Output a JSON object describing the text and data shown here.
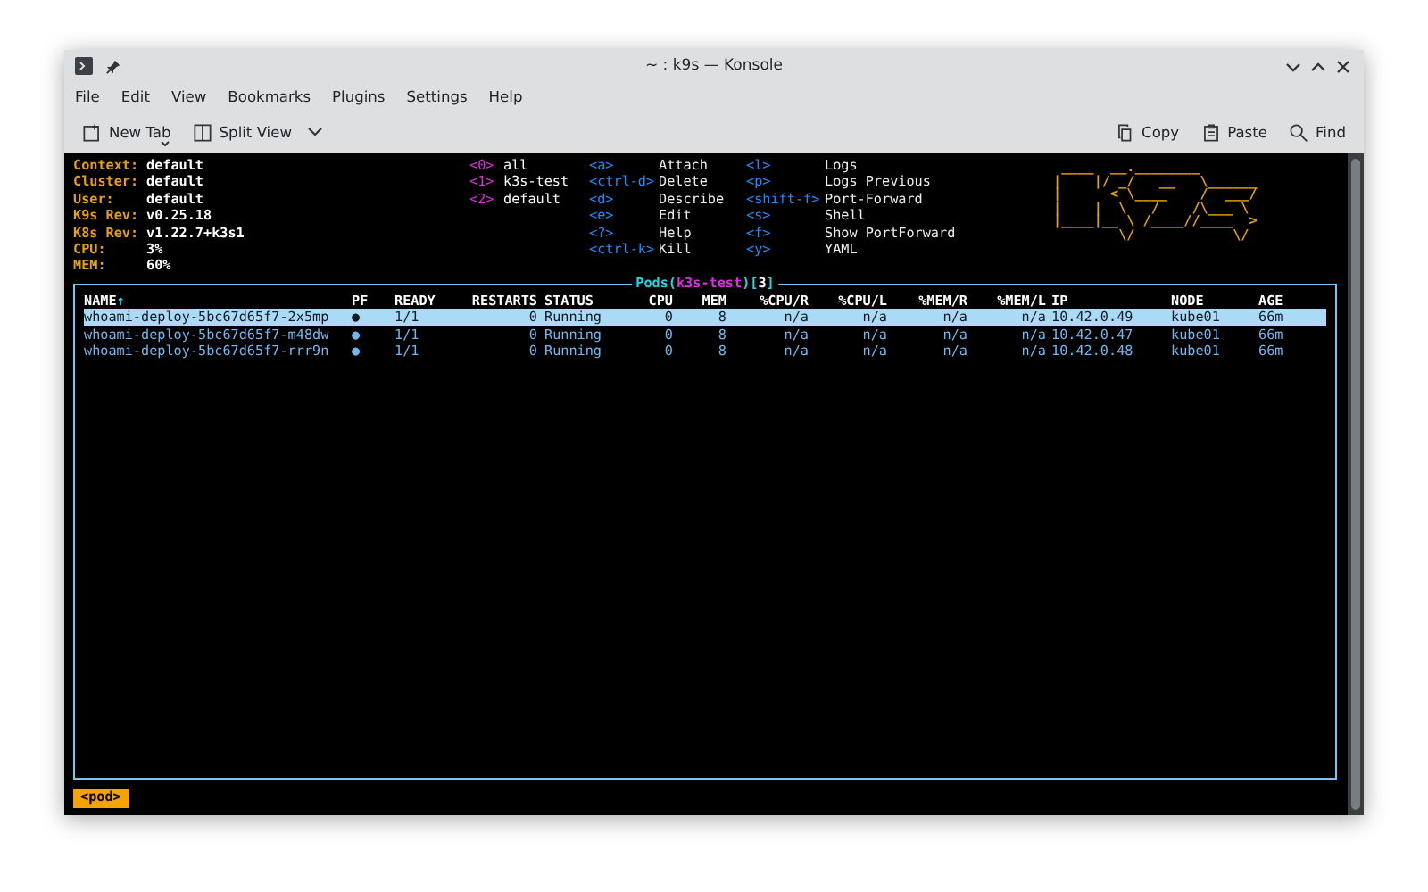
{
  "window": {
    "title": "~ : k9s — Konsole"
  },
  "menu": [
    "File",
    "Edit",
    "View",
    "Bookmarks",
    "Plugins",
    "Settings",
    "Help"
  ],
  "toolbar": {
    "left": [
      {
        "label": "New Tab",
        "kind": "new-tab"
      },
      {
        "label": "Split View",
        "kind": "split-view"
      }
    ],
    "right": [
      {
        "label": "Copy",
        "kind": "copy"
      },
      {
        "label": "Paste",
        "kind": "paste"
      },
      {
        "label": "Find",
        "kind": "find"
      }
    ]
  },
  "info": [
    {
      "label": "Context:",
      "value": "default"
    },
    {
      "label": "Cluster:",
      "value": "default"
    },
    {
      "label": "User:",
      "value": "default"
    },
    {
      "label": "K9s Rev:",
      "value": "v0.25.18"
    },
    {
      "label": "K8s Rev:",
      "value": "v1.22.7+k3s1"
    },
    {
      "label": "CPU:",
      "value": "3%"
    },
    {
      "label": "MEM:",
      "value": "60%"
    }
  ],
  "namespaces": [
    {
      "key": "<0>",
      "name": "all"
    },
    {
      "key": "<1>",
      "name": "k3s-test"
    },
    {
      "key": "<2>",
      "name": "default"
    }
  ],
  "shortcuts": [
    [
      {
        "key": "<a>",
        "action": "Attach"
      },
      {
        "key": "<ctrl-d>",
        "action": "Delete"
      },
      {
        "key": "<d>",
        "action": "Describe"
      },
      {
        "key": "<e>",
        "action": "Edit"
      },
      {
        "key": "<?>",
        "action": "Help"
      },
      {
        "key": "<ctrl-k>",
        "action": "Kill"
      }
    ],
    [
      {
        "key": "<l>",
        "action": "Logs"
      },
      {
        "key": "<p>",
        "action": "Logs Previous"
      },
      {
        "key": "<shift-f>",
        "action": "Port-Forward"
      },
      {
        "key": "<s>",
        "action": "Shell"
      },
      {
        "key": "<f>",
        "action": "Show PortForward"
      },
      {
        "key": "<y>",
        "action": "YAML"
      }
    ]
  ],
  "logo": [
    " ____  __.________       ",
    "|    |/ _/   __   \\______",
    "|      < \\____    /  ___/",
    "|    |  \\   /    /\\___ \\ ",
    "|____|__ \\ /____//____  >",
    "        \\/            \\/ "
  ],
  "table": {
    "title_parts": [
      {
        "text": "Pods(",
        "kind": "resource"
      },
      {
        "text": "k3s-test",
        "kind": "namespace"
      },
      {
        "text": ")[",
        "kind": "resource"
      },
      {
        "text": "3",
        "kind": "count"
      },
      {
        "text": "]",
        "kind": "resource"
      }
    ],
    "columns": [
      {
        "label": "NAME",
        "sort": "↑"
      },
      {
        "label": "PF"
      },
      {
        "label": "READY"
      },
      {
        "label": "RESTARTS"
      },
      {
        "label": "STATUS"
      },
      {
        "label": "CPU"
      },
      {
        "label": "MEM"
      },
      {
        "label": "%CPU/R"
      },
      {
        "label": "%CPU/L"
      },
      {
        "label": "%MEM/R"
      },
      {
        "label": "%MEM/L"
      },
      {
        "label": "IP"
      },
      {
        "label": "NODE"
      },
      {
        "label": "AGE"
      }
    ],
    "rows": [
      {
        "selected": true,
        "cells": [
          "whoami-deploy-5bc67d65f7-2x5mp",
          "●",
          "1/1",
          "0",
          "Running",
          "0",
          "8",
          "n/a",
          "n/a",
          "n/a",
          "n/a",
          "10.42.0.49",
          "kube01",
          "66m"
        ]
      },
      {
        "selected": false,
        "cells": [
          "whoami-deploy-5bc67d65f7-m48dw",
          "●",
          "1/1",
          "0",
          "Running",
          "0",
          "8",
          "n/a",
          "n/a",
          "n/a",
          "n/a",
          "10.42.0.47",
          "kube01",
          "66m"
        ]
      },
      {
        "selected": false,
        "cells": [
          "whoami-deploy-5bc67d65f7-rrr9n",
          "●",
          "1/1",
          "0",
          "Running",
          "0",
          "8",
          "n/a",
          "n/a",
          "n/a",
          "n/a",
          "10.42.0.48",
          "kube01",
          "66m"
        ]
      }
    ]
  },
  "crumb": "<pod>"
}
